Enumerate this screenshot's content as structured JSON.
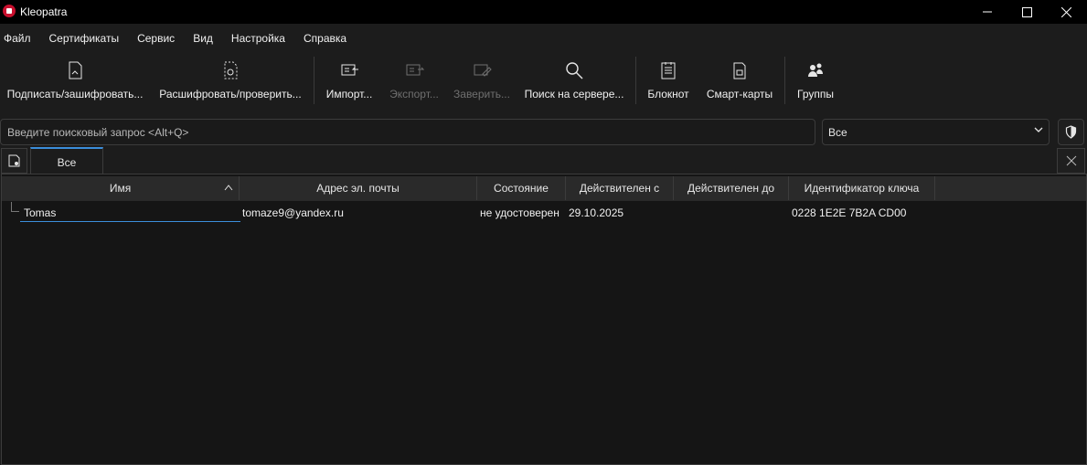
{
  "window": {
    "title": "Kleopatra",
    "controls": [
      "minimize",
      "maximize",
      "close"
    ]
  },
  "menu": [
    "Файл",
    "Сертификаты",
    "Сервис",
    "Вид",
    "Настройка",
    "Справка"
  ],
  "toolbar": {
    "sign": {
      "label": "Подписать/зашифровать...",
      "icon": "sign-encrypt-icon"
    },
    "decrypt": {
      "label": "Расшифровать/проверить...",
      "icon": "decrypt-verify-icon"
    },
    "import": {
      "label": "Импорт...",
      "icon": "import-icon"
    },
    "export": {
      "label": "Экспорт...",
      "icon": "export-icon",
      "disabled": true
    },
    "certify": {
      "label": "Заверить...",
      "icon": "certify-icon",
      "disabled": true
    },
    "lookup": {
      "label": "Поиск на сервере...",
      "icon": "search-icon"
    },
    "notepad": {
      "label": "Блокнот",
      "icon": "notepad-icon"
    },
    "smartcards": {
      "label": "Смарт-карты",
      "icon": "smartcard-icon"
    },
    "groups": {
      "label": "Группы",
      "icon": "groups-icon"
    }
  },
  "search": {
    "placeholder": "Введите поисковый запрос <Alt+Q>"
  },
  "filter": {
    "selected": "Все"
  },
  "tabs": [
    {
      "label": "Все",
      "active": true
    }
  ],
  "table": {
    "columns": [
      "Имя",
      "Адрес эл. почты",
      "Состояние",
      "Действителен с",
      "Действителен до",
      "Идентификатор ключа"
    ],
    "sorted_column": "Имя",
    "rows": [
      {
        "name": "Tomas",
        "email": "tomaze9@yandex.ru",
        "status": "не удостоверен",
        "valid_from": "29.10.2025",
        "valid_until": "",
        "key_id": "0228 1E2E 7B2A CD00"
      }
    ]
  },
  "colors": {
    "accent": "#3b8edb",
    "background": "#1c1c1c",
    "titlebar": "#000000"
  }
}
